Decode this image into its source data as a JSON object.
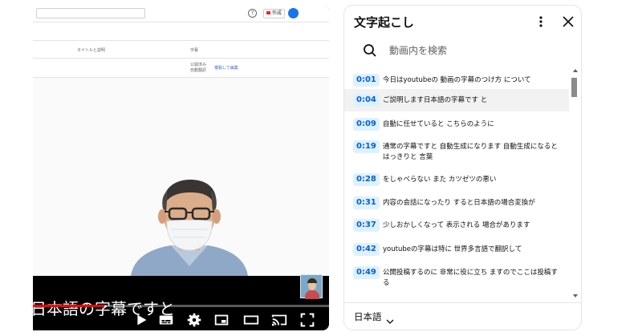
{
  "studio": {
    "help_icon": "?",
    "create_label": "作成",
    "col_title": "タイトルと説明",
    "col_subtitles": "字幕",
    "row_status_1": "公開済み",
    "row_status_2": "自動翻訳",
    "row_action": "複製して編集"
  },
  "player": {
    "caption": "日本語の字幕ですと",
    "progress": 0.24,
    "controls": [
      {
        "name": "play-icon"
      },
      {
        "name": "next-icon"
      },
      {
        "name": "subtitles-icon"
      },
      {
        "name": "settings-icon"
      },
      {
        "name": "miniplayer-icon"
      },
      {
        "name": "theater-icon"
      },
      {
        "name": "cast-icon"
      },
      {
        "name": "fullscreen-icon"
      }
    ]
  },
  "transcript": {
    "title": "文字起こし",
    "search_placeholder": "動画内を検索",
    "language": "日本語",
    "segments": [
      {
        "time": "0:01",
        "text": "今日はyoutubeの 動画の字幕のつけ方 について"
      },
      {
        "time": "0:04",
        "text": "ご説明します日本語の字幕です と",
        "active": true
      },
      {
        "time": "0:09",
        "text": "自動に任せていると こちらのように"
      },
      {
        "time": "0:19",
        "text": "通常の字幕ですと 自動生成になります 自動生成になるとはっきりと 言葉"
      },
      {
        "time": "0:28",
        "text": "をしゃべらない また カツゼツの悪い"
      },
      {
        "time": "0:31",
        "text": "内容の会話になったり すると日本語の場合変換が"
      },
      {
        "time": "0:37",
        "text": "少しおかしくなって 表示される 場合があります"
      },
      {
        "time": "0:42",
        "text": "youtubeの字幕は特に 世界多言語で翻訳して"
      },
      {
        "time": "0:49",
        "text": "公開投稿するのに 非常に役に立ち ますのでここは投稿する"
      }
    ]
  },
  "colors": {
    "accent_blue": "#065fd4",
    "timestamp_bg": "#def1ff",
    "active_row": "#f2f2f2",
    "progress_red": "#ff0000"
  }
}
